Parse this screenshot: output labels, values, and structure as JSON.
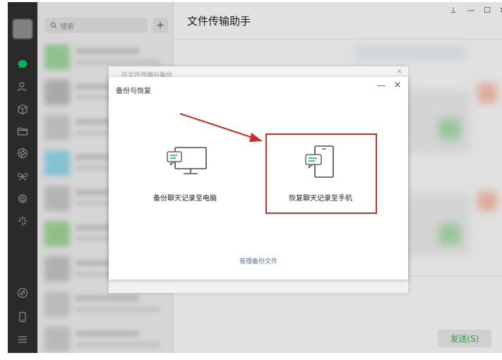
{
  "search": {
    "placeholder": "搜索",
    "add_label": "+"
  },
  "chat": {
    "title": "文件传输助手",
    "send_label": "发送(S)"
  },
  "window_controls": {
    "pin": "⊥",
    "minimize": "—",
    "maximize": "☐",
    "close": "✕"
  },
  "back_dialog": {
    "title": "在文件传输与备份",
    "close": "×"
  },
  "dialog": {
    "title": "备份与恢复",
    "minimize": "—",
    "close": "×",
    "backup_option_label": "备份聊天记录至电脑",
    "restore_option_label": "恢复聊天记录至手机",
    "manage_link": "管理备份文件"
  },
  "icons": {
    "chat": "chat-bubble-icon",
    "contacts": "contacts-icon",
    "favorites": "cube-icon",
    "files": "folder-icon",
    "moments": "aperture-icon",
    "channels": "butterfly-icon",
    "settings": "gear-icon",
    "discover": "sparkle-icon",
    "mini_program": "link-icon",
    "phone": "phone-icon",
    "menu": "menu-icon"
  },
  "colors": {
    "accent": "#07c160",
    "annotation": "#c6322a",
    "sidebar": "#2e2e2e"
  }
}
